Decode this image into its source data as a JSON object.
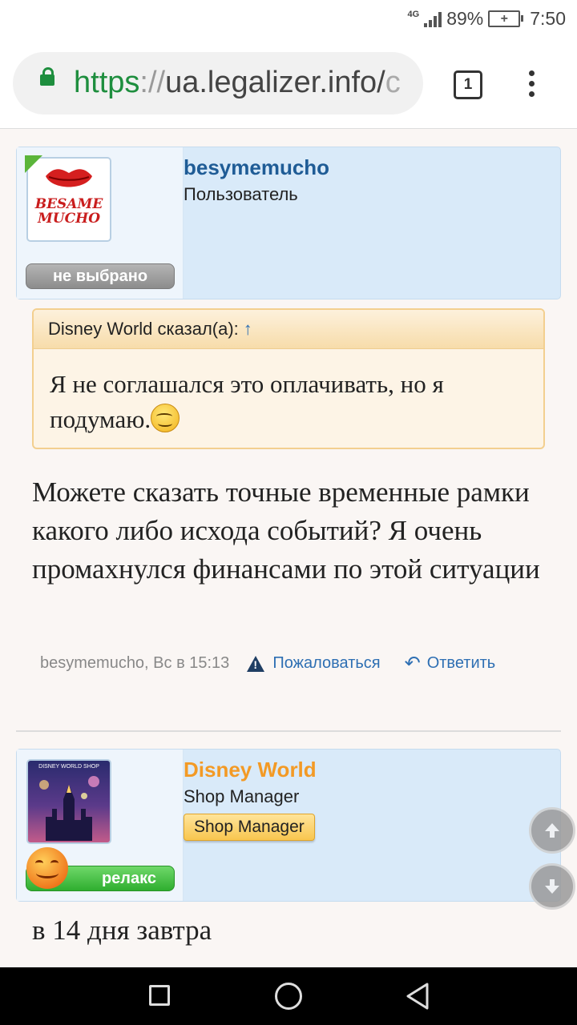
{
  "status_bar": {
    "network": "4G",
    "battery_percent": "89%",
    "time": "7:50"
  },
  "browser": {
    "url_scheme": "https",
    "url_sep": "://",
    "url_host": "ua.legalizer.info/",
    "url_tail": "c",
    "tab_count": "1"
  },
  "post1": {
    "avatar_text_1": "BESAME",
    "avatar_text_2": "MUCHO",
    "status_label": "не выбрано",
    "username": "besymemucho",
    "user_title": "Пользователь",
    "quote_header": "Disney World сказал(а):",
    "quote_arrow": "↑",
    "quote_text": "Я не соглашался это оплачивать, но я подумаю.",
    "message": "Можете сказать точные временные рамки какого либо исхода событий? Я очень промахнулся финансами по этой ситуации",
    "meta_author_date": "besymemucho, Вс в 15:13",
    "report_label": "Пожаловаться",
    "reply_label": "Ответить"
  },
  "post2": {
    "avatar_caption": "DISNEY WORLD SHOP",
    "status_label": "релакс",
    "username": "Disney World",
    "user_title": "Shop Manager",
    "badge": "Shop Manager",
    "message": "в 14 дня завтра"
  },
  "scroll": {
    "up_icon": "arrow-up-icon",
    "down_icon": "arrow-down-icon"
  },
  "colors": {
    "post_bg": "#d9eaf9",
    "link_blue": "#2e6fb3",
    "username1": "#1f5c96",
    "username2": "#f39a25",
    "secure_green": "#1e8e3e",
    "status_gray": "#8e8e8e",
    "status_green": "#3cb93c"
  }
}
